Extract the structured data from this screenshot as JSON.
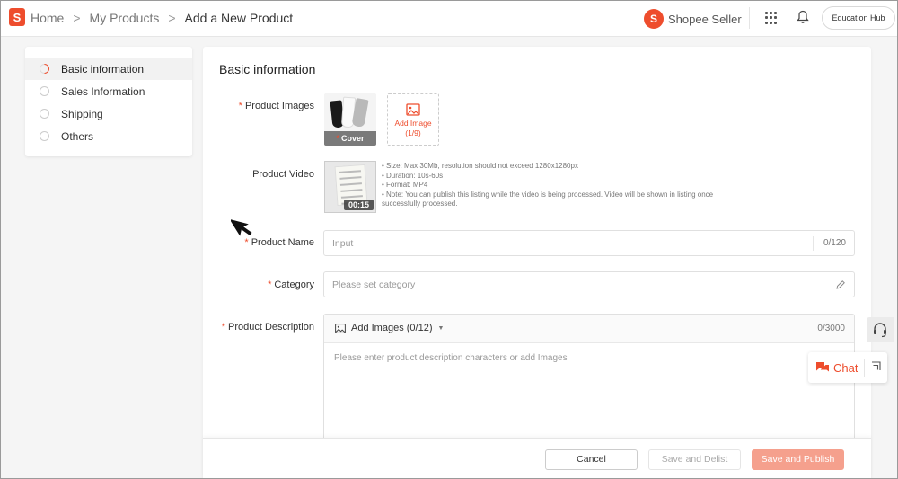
{
  "header": {
    "logo_glyph": "S",
    "breadcrumb": [
      "Home",
      "My Products",
      "Add a New Product"
    ],
    "breadcrumb_sep": ">",
    "brand_glyph": "S",
    "brand": "Shopee Seller",
    "education_hub": "Education Hub",
    "icons": [
      "apps-grid-icon",
      "bell-icon"
    ]
  },
  "sidebar": {
    "items": [
      {
        "label": "Basic information",
        "active": true
      },
      {
        "label": "Sales Information",
        "active": false
      },
      {
        "label": "Shipping",
        "active": false
      },
      {
        "label": "Others",
        "active": false
      }
    ]
  },
  "form": {
    "section_title": "Basic information",
    "required_mark": "*",
    "product_images": {
      "label": "Product Images",
      "cover_star": "*",
      "cover_label": "Cover",
      "add_label": "Add Image",
      "add_count": "(1/9)"
    },
    "product_video": {
      "label": "Product Video",
      "duration": "00:15",
      "notes": [
        "Size: Max 30Mb, resolution should not exceed 1280x1280px",
        "Duration: 10s-60s",
        "Format: MP4",
        "Note: You can publish this listing while the video is being processed. Video will be shown in listing once successfully processed."
      ]
    },
    "product_name": {
      "label": "Product Name",
      "placeholder": "Input",
      "count": "0/120"
    },
    "category": {
      "label": "Category",
      "placeholder": "Please set category"
    },
    "description": {
      "label": "Product Description",
      "add_images": "Add Images (0/12)",
      "count": "0/3000",
      "placeholder": "Please enter product description characters or add Images"
    }
  },
  "footer": {
    "cancel": "Cancel",
    "save_delist": "Save and Delist",
    "save_publish": "Save and Publish"
  },
  "floating": {
    "chat": "Chat"
  },
  "colors": {
    "accent": "#ee4d2d",
    "publish_disabled": "#f5a08d"
  }
}
